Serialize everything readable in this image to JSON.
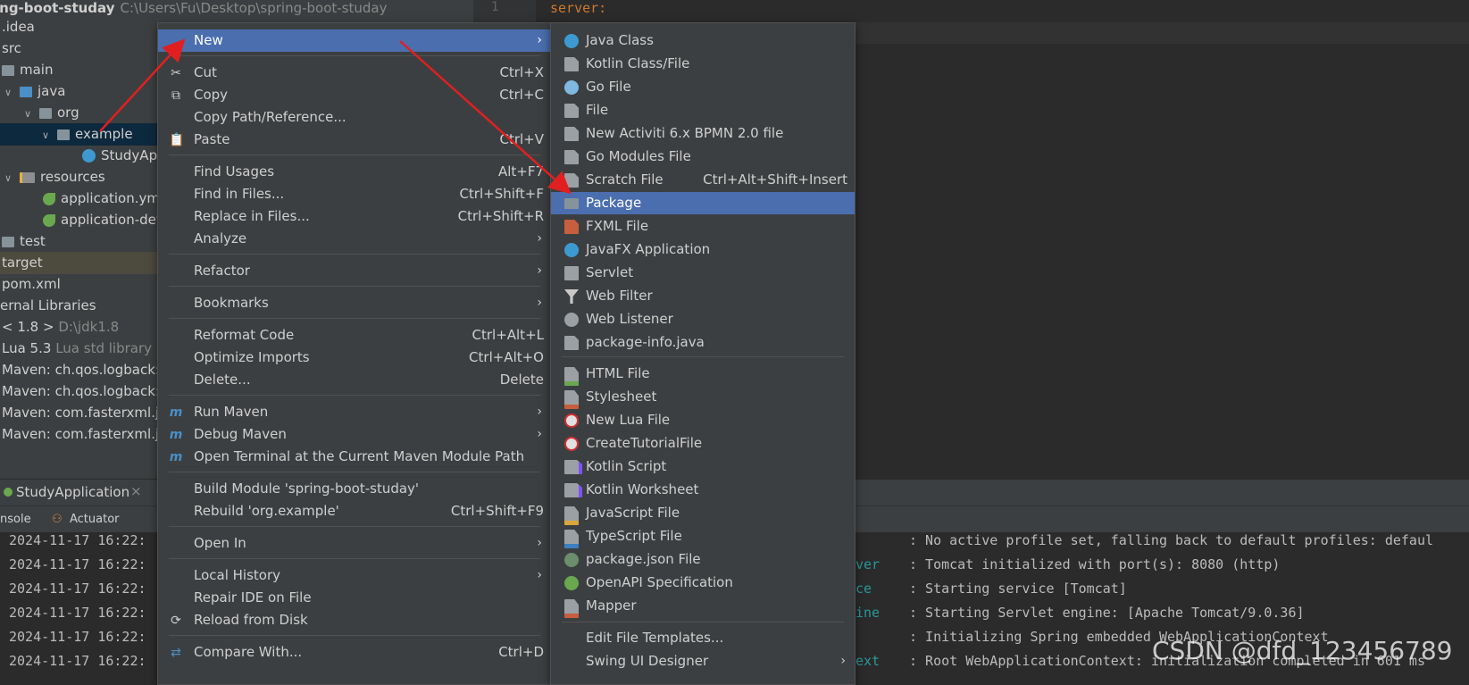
{
  "tree": {
    "project_name": "ing-boot-studay",
    "project_path": "C:\\Users\\Fu\\Desktop\\spring-boot-studay",
    "items": [
      {
        "label": ".idea",
        "sub": ""
      },
      {
        "label": "src",
        "sub": ""
      },
      {
        "label": "main",
        "sub": ""
      },
      {
        "label": "java",
        "sub": ""
      },
      {
        "label": "org",
        "sub": ""
      },
      {
        "label": "example",
        "sub": ""
      },
      {
        "label": "StudyAp",
        "sub": ""
      },
      {
        "label": "resources",
        "sub": ""
      },
      {
        "label": "application.ym",
        "sub": ""
      },
      {
        "label": "application-dev",
        "sub": ""
      },
      {
        "label": "test",
        "sub": ""
      },
      {
        "label": "target",
        "sub": ""
      },
      {
        "label": "pom.xml",
        "sub": ""
      },
      {
        "label": "ernal Libraries",
        "sub": ""
      },
      {
        "label": "< 1.8 >",
        "sub": "D:\\jdk1.8"
      },
      {
        "label": "Lua 5.3",
        "sub": "Lua std library"
      },
      {
        "label": "Maven: ch.qos.logback:l",
        "sub": ""
      },
      {
        "label": "Maven: ch.qos.logback:l",
        "sub": ""
      },
      {
        "label": "Maven: com.fasterxml.ja",
        "sub": ""
      },
      {
        "label": "Maven: com.fasterxml.ja",
        "sub": ""
      }
    ]
  },
  "editor": {
    "line_number": "1",
    "code_line": "server:"
  },
  "run": {
    "tab_label": "StudyApplication",
    "close": "×"
  },
  "tabs": {
    "console": "nsole",
    "actuator": "Actuator"
  },
  "console": {
    "times": [
      "2024-11-17 16:22:",
      "2024-11-17 16:22:",
      "2024-11-17 16:22:",
      "2024-11-17 16:22:",
      "2024-11-17 16:22:",
      "2024-11-17 16:22:"
    ],
    "sources": [
      "",
      "ver",
      "ce",
      "ine",
      "",
      "ext"
    ],
    "messages": [
      ": No active profile set, falling back to default profiles: defaul",
      ": Tomcat initialized with port(s): 8080 (http)",
      ": Starting service [Tomcat]",
      ": Starting Servlet engine: [Apache Tomcat/9.0.36]",
      ": Initializing Spring embedded WebApplicationContext",
      ": Root WebApplicationContext: initialization completed in 601 ms"
    ]
  },
  "menu": [
    {
      "label": "New",
      "shortcut": "",
      "arrow": "›",
      "icon": ""
    },
    {
      "label": "Cut",
      "shortcut": "Ctrl+X",
      "arrow": "",
      "icon": "scissors-icon"
    },
    {
      "label": "Copy",
      "shortcut": "Ctrl+C",
      "arrow": "",
      "icon": "copy-icon"
    },
    {
      "label": "Copy Path/Reference...",
      "shortcut": "",
      "arrow": "",
      "icon": ""
    },
    {
      "label": "Paste",
      "shortcut": "Ctrl+V",
      "arrow": "",
      "icon": "clipboard-icon"
    },
    {
      "label": "Find Usages",
      "shortcut": "Alt+F7",
      "arrow": "",
      "icon": ""
    },
    {
      "label": "Find in Files...",
      "shortcut": "Ctrl+Shift+F",
      "arrow": "",
      "icon": ""
    },
    {
      "label": "Replace in Files...",
      "shortcut": "Ctrl+Shift+R",
      "arrow": "",
      "icon": ""
    },
    {
      "label": "Analyze",
      "shortcut": "",
      "arrow": "›",
      "icon": ""
    },
    {
      "label": "Refactor",
      "shortcut": "",
      "arrow": "›",
      "icon": ""
    },
    {
      "label": "Bookmarks",
      "shortcut": "",
      "arrow": "›",
      "icon": ""
    },
    {
      "label": "Reformat Code",
      "shortcut": "Ctrl+Alt+L",
      "arrow": "",
      "icon": ""
    },
    {
      "label": "Optimize Imports",
      "shortcut": "Ctrl+Alt+O",
      "arrow": "",
      "icon": ""
    },
    {
      "label": "Delete...",
      "shortcut": "Delete",
      "arrow": "",
      "icon": ""
    },
    {
      "label": "Run Maven",
      "shortcut": "",
      "arrow": "›",
      "icon": "maven-icon"
    },
    {
      "label": "Debug Maven",
      "shortcut": "",
      "arrow": "›",
      "icon": "maven-debug-icon"
    },
    {
      "label": "Open Terminal at the Current Maven Module Path",
      "shortcut": "",
      "arrow": "",
      "icon": "terminal-icon"
    },
    {
      "label": "Build Module 'spring-boot-studay'",
      "shortcut": "",
      "arrow": "",
      "icon": ""
    },
    {
      "label": "Rebuild 'org.example'",
      "shortcut": "Ctrl+Shift+F9",
      "arrow": "",
      "icon": ""
    },
    {
      "label": "Open In",
      "shortcut": "",
      "arrow": "›",
      "icon": ""
    },
    {
      "label": "Local History",
      "shortcut": "",
      "arrow": "›",
      "icon": ""
    },
    {
      "label": "Repair IDE on File",
      "shortcut": "",
      "arrow": "",
      "icon": ""
    },
    {
      "label": "Reload from Disk",
      "shortcut": "",
      "arrow": "",
      "icon": "reload-icon"
    },
    {
      "label": "Compare With...",
      "shortcut": "Ctrl+D",
      "arrow": "",
      "icon": "compare-icon"
    }
  ],
  "submenu": [
    {
      "label": "Java Class",
      "shortcut": "",
      "icon": "java-class-icon",
      "color": "#3d9ad1"
    },
    {
      "label": "Kotlin Class/File",
      "shortcut": "",
      "icon": "kotlin-file-icon",
      "color": "#9ba0a4"
    },
    {
      "label": "Go File",
      "shortcut": "",
      "icon": "go-gopher-icon",
      "color": "#7fb8e0"
    },
    {
      "label": "File",
      "shortcut": "",
      "icon": "file-icon",
      "color": "#9ba0a4"
    },
    {
      "label": "New Activiti 6.x BPMN 2.0 file",
      "shortcut": "",
      "icon": "bpmn-icon",
      "color": "#9ba0a4"
    },
    {
      "label": "Go Modules File",
      "shortcut": "",
      "icon": "go-mod-icon",
      "color": "#9ba0a4"
    },
    {
      "label": "Scratch File",
      "shortcut": "Ctrl+Alt+Shift+Insert",
      "icon": "scratch-file-icon",
      "color": "#9ba0a4"
    },
    {
      "label": "Package",
      "shortcut": "",
      "icon": "package-icon",
      "color": "#87939a"
    },
    {
      "label": "FXML File",
      "shortcut": "",
      "icon": "fxml-icon",
      "color": "#c75f3e"
    },
    {
      "label": "JavaFX Application",
      "shortcut": "",
      "icon": "javafx-icon",
      "color": "#3d9ad1"
    },
    {
      "label": "Servlet",
      "shortcut": "",
      "icon": "servlet-icon",
      "color": "#9ba0a4"
    },
    {
      "label": "Web Filter",
      "shortcut": "",
      "icon": "filter-icon",
      "color": "#c8c8c8"
    },
    {
      "label": "Web Listener",
      "shortcut": "",
      "icon": "listener-icon",
      "color": "#9ba0a4"
    },
    {
      "label": "package-info.java",
      "shortcut": "",
      "icon": "package-info-icon",
      "color": "#9ba0a4"
    },
    {
      "label": "HTML File",
      "shortcut": "",
      "icon": "html-icon",
      "color": "#9ba0a4"
    },
    {
      "label": "Stylesheet",
      "shortcut": "",
      "icon": "css-icon",
      "color": "#9ba0a4"
    },
    {
      "label": "New Lua File",
      "shortcut": "",
      "icon": "lua-icon",
      "color": "#e0e0e0"
    },
    {
      "label": "CreateTutorialFile",
      "shortcut": "",
      "icon": "tutorial-icon",
      "color": "#e0e0e0"
    },
    {
      "label": "Kotlin Script",
      "shortcut": "",
      "icon": "kotlin-script-icon",
      "color": "#9ba0a4"
    },
    {
      "label": "Kotlin Worksheet",
      "shortcut": "",
      "icon": "kotlin-worksheet-icon",
      "color": "#9ba0a4"
    },
    {
      "label": "JavaScript File",
      "shortcut": "",
      "icon": "js-icon",
      "color": "#9ba0a4"
    },
    {
      "label": "TypeScript File",
      "shortcut": "",
      "icon": "ts-icon",
      "color": "#9ba0a4"
    },
    {
      "label": "package.json File",
      "shortcut": "",
      "icon": "package-json-icon",
      "color": "#6b8e6b"
    },
    {
      "label": "OpenAPI Specification",
      "shortcut": "",
      "icon": "openapi-icon",
      "color": "#6aa84f"
    },
    {
      "label": "Mapper",
      "shortcut": "",
      "icon": "mapper-icon",
      "color": "#9ba0a4"
    },
    {
      "label": "Edit File Templates...",
      "shortcut": "",
      "icon": "",
      "color": ""
    },
    {
      "label": "Swing UI Designer",
      "shortcut": "",
      "icon": "",
      "color": ""
    }
  ],
  "watermark": "CSDN @dfd_123456789",
  "colors": {
    "highlight": "#4b6eaf",
    "arrow": "#e02020"
  }
}
